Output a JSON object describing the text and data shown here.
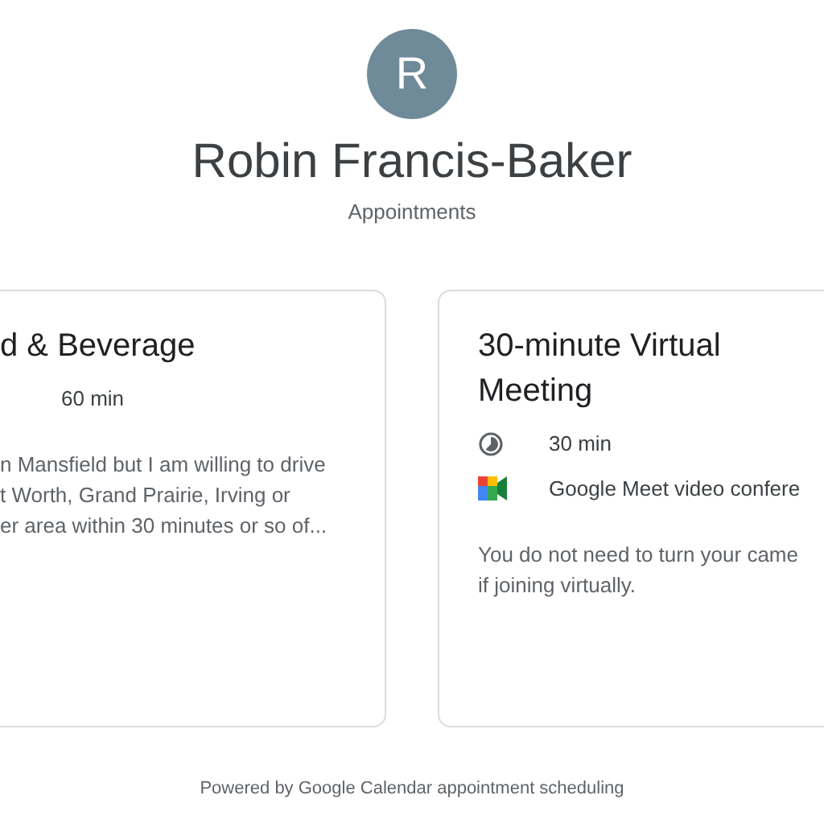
{
  "profile": {
    "initial": "R",
    "name": "Robin Francis-Baker",
    "subtitle": "Appointments"
  },
  "cards": [
    {
      "title": "d & Beverage",
      "details": [
        {
          "text": "60 min"
        }
      ],
      "description_lines": [
        "n Mansfield but I am willing to drive",
        "t Worth, Grand Prairie, Irving or",
        "er area within 30 minutes or so of..."
      ]
    },
    {
      "title": "30-minute Virtual Meeting",
      "details": [
        {
          "kind": "duration",
          "text": "30 min"
        },
        {
          "kind": "video",
          "text": "Google Meet video confere"
        }
      ],
      "description_lines": [
        "You do not need to turn your came",
        "if joining virtually."
      ]
    }
  ],
  "footer": "Powered by Google Calendar appointment scheduling"
}
